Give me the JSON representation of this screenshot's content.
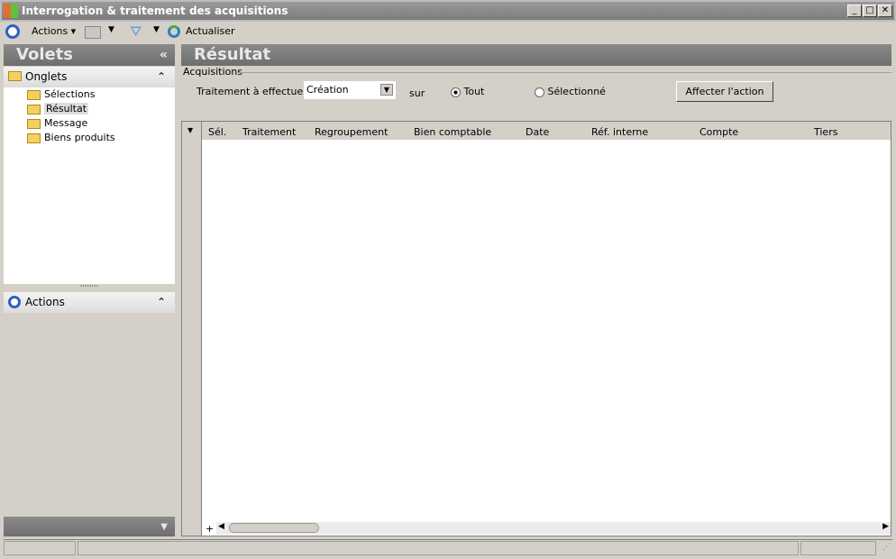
{
  "window": {
    "title": "Interrogation & traitement des acquisitions"
  },
  "toolbar": {
    "actions": "Actions",
    "refresh": "Actualiser"
  },
  "left": {
    "title": "Volets",
    "collapse": "«",
    "onglets": "Onglets",
    "items": [
      "Sélections",
      "Résultat",
      "Message",
      "Biens produits"
    ],
    "actions": "Actions"
  },
  "main": {
    "title": "Résultat",
    "group": "Acquisitions",
    "traitement_label": "Traitement à effectuer :",
    "traitement_value": "Création",
    "sur": "sur",
    "radio_all": "Tout",
    "radio_sel": "Sélectionné",
    "apply": "Affecter l'action",
    "columns": [
      "Sél.",
      "Traitement",
      "Regroupement",
      "Bien comptable",
      "Date",
      "Réf. interne",
      "Compte",
      "Tiers"
    ]
  }
}
